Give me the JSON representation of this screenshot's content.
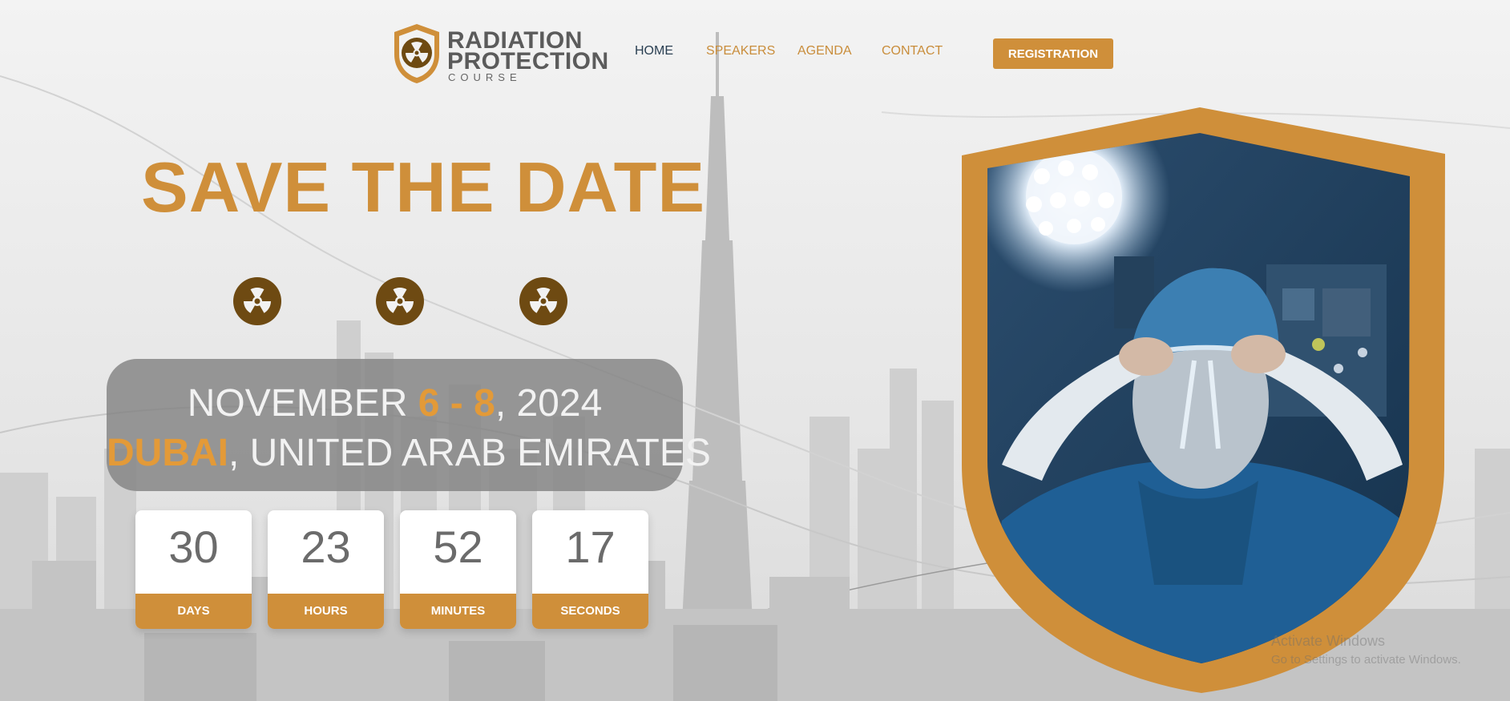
{
  "logo": {
    "line1": "RADIATION",
    "line2": "PROTECTION",
    "line3": "COURSE",
    "icon": "radiation-shield-icon"
  },
  "nav": {
    "items": [
      {
        "label": "HOME",
        "active": true
      },
      {
        "label": "SPEAKERS",
        "active": false
      },
      {
        "label": "AGENDA",
        "active": false
      },
      {
        "label": "CONTACT",
        "active": false
      }
    ],
    "registration_label": "REGISTRATION"
  },
  "hero": {
    "headline": "SAVE THE DATE",
    "icons": [
      "radiation-icon",
      "radiation-icon",
      "radiation-icon"
    ],
    "date": {
      "month": "NOVEMBER ",
      "days": "6 - 8",
      "year": ", 2024"
    },
    "location": {
      "city": "DUBAI",
      "country": ", UNITED ARAB EMIRATES"
    }
  },
  "countdown": [
    {
      "value": "30",
      "label": "DAYS"
    },
    {
      "value": "23",
      "label": "HOURS"
    },
    {
      "value": "52",
      "label": "MINUTES"
    },
    {
      "value": "17",
      "label": "SECONDS"
    }
  ],
  "image": {
    "subject": "surgeon-tying-scrub-cap-photo",
    "frame": "shield-frame"
  },
  "watermark": {
    "line1": "Activate Windows",
    "line2": "Go to Settings to activate Windows."
  },
  "colors": {
    "accent": "#cf8f3a",
    "accent_bright": "#e39a38",
    "nav_active": "#2a3f52",
    "icon_brown": "#6e4a12",
    "date_box": "#828282",
    "photo_blue": "#1e4a70"
  }
}
